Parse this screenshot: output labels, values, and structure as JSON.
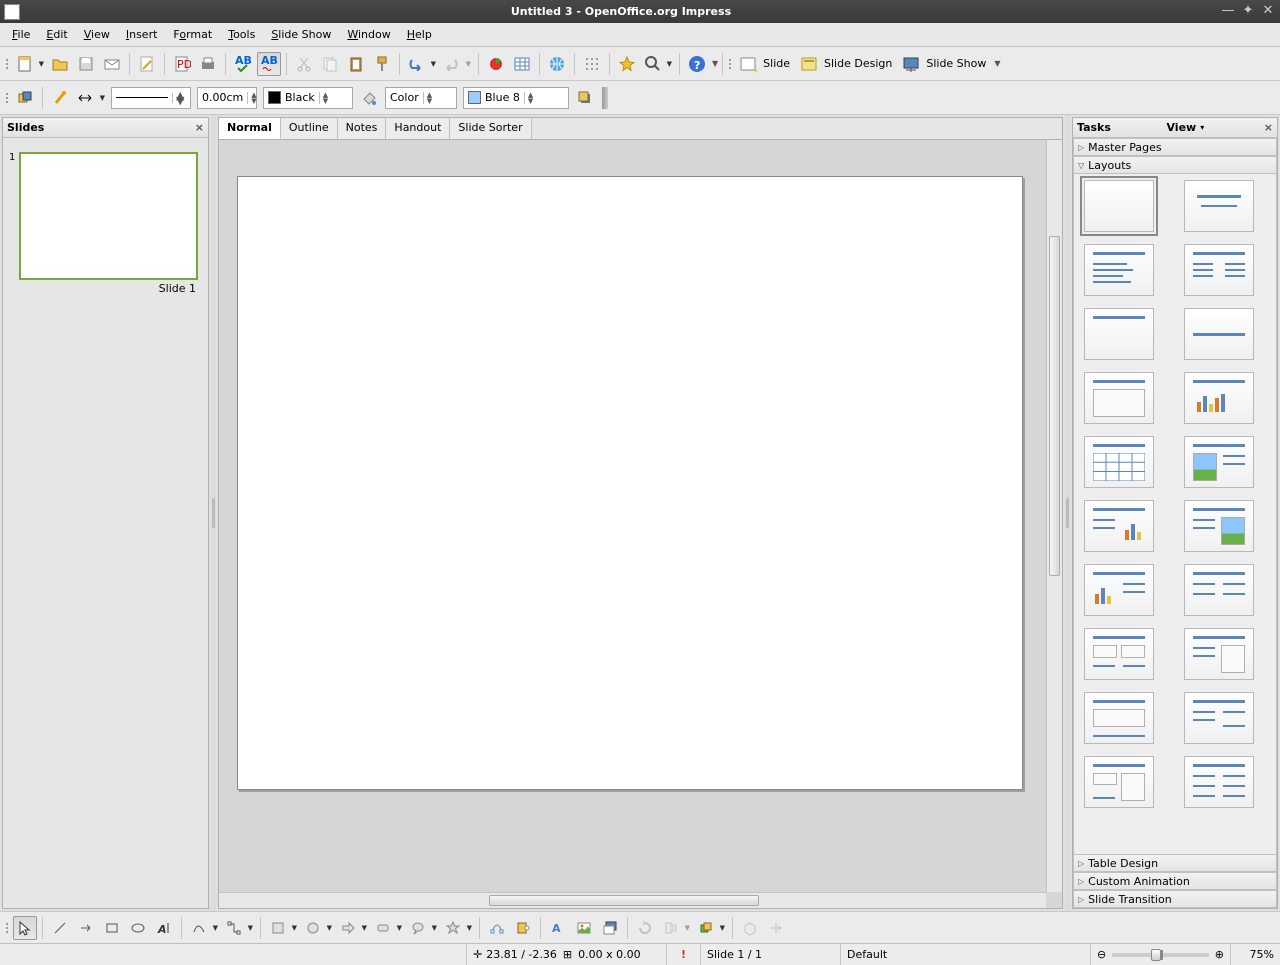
{
  "titlebar": {
    "title": "Untitled 3 - OpenOffice.org Impress"
  },
  "menu": {
    "file": "File",
    "edit": "Edit",
    "view": "View",
    "insert": "Insert",
    "format": "Format",
    "tools": "Tools",
    "slideshow": "Slide Show",
    "window": "Window",
    "help": "Help"
  },
  "toolbar1": {
    "slide": "Slide",
    "slide_design": "Slide Design",
    "slide_show": "Slide Show"
  },
  "toolbar2": {
    "line_width": "0.00cm",
    "line_color": "Black",
    "fill_type": "Color",
    "fill_color": "Blue 8"
  },
  "slides_panel": {
    "title": "Slides",
    "thumb_num": "1",
    "thumb_label": "Slide 1"
  },
  "tabs": {
    "normal": "Normal",
    "outline": "Outline",
    "notes": "Notes",
    "handout": "Handout",
    "sorter": "Slide Sorter"
  },
  "tasks": {
    "title": "Tasks",
    "view": "View",
    "sections": {
      "master": "Master Pages",
      "layouts": "Layouts",
      "table": "Table Design",
      "anim": "Custom Animation",
      "trans": "Slide Transition"
    }
  },
  "status": {
    "coords": "23.81 / -2.36",
    "size": "0.00 x 0.00",
    "slide": "Slide 1 / 1",
    "template": "Default",
    "zoom": "75%"
  }
}
